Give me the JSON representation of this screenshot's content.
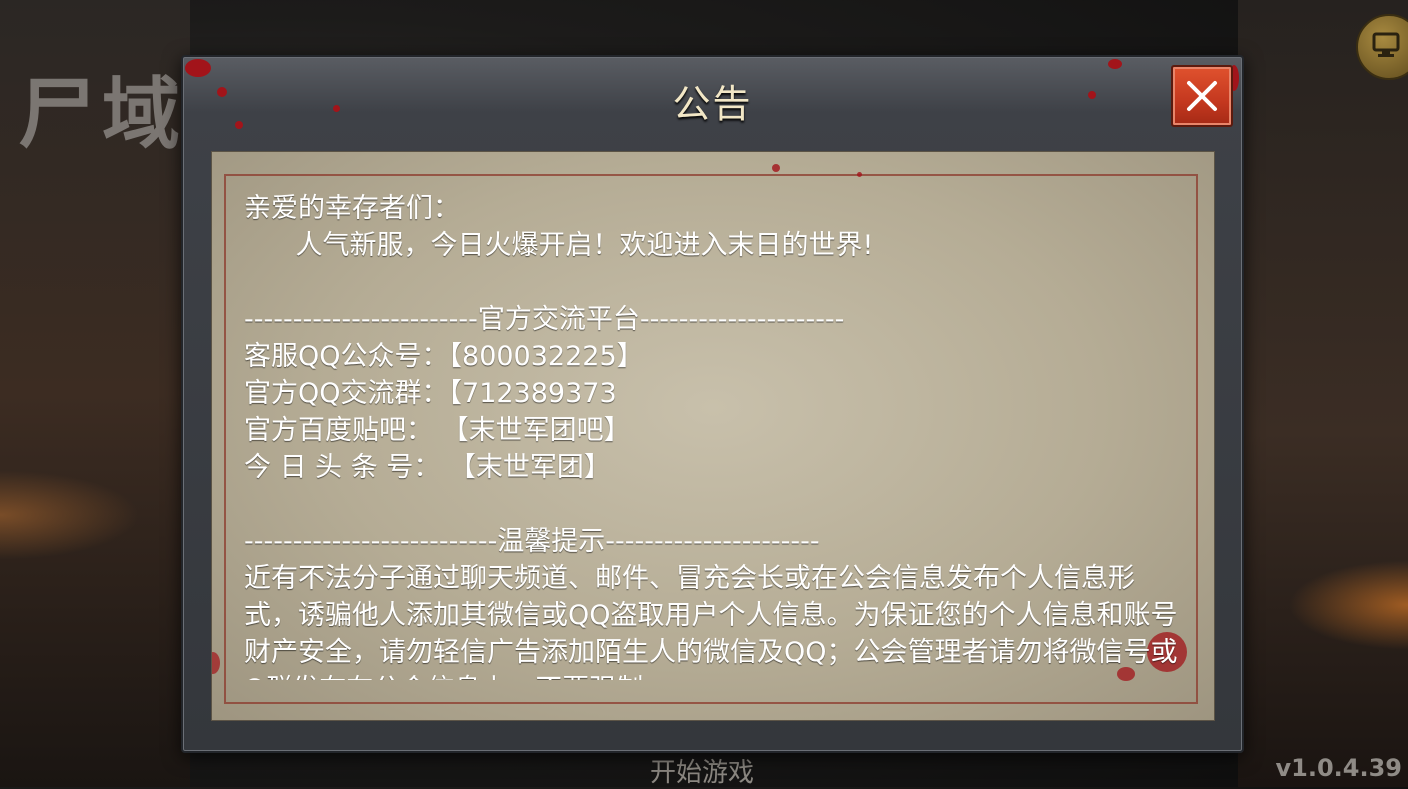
{
  "background": {
    "game_logo": "尸域",
    "start_button_label": "开始游戏",
    "version": "v1.0.4.39",
    "monitor_icon": "monitor-icon"
  },
  "dialog": {
    "title": "公告",
    "close_icon": "close-x-icon",
    "colors": {
      "title_text": "#f2e7c6",
      "close_button": "#d84a2a",
      "parchment": "#bdb49e",
      "body_text": "#ffffff",
      "frame_line": "#8c3a2c"
    },
    "greeting": "亲爱的幸存者们：",
    "intro": "      人气新服，今日火爆开启！欢迎进入末日的世界!",
    "section1_header": "------------------------官方交流平台---------------------",
    "contacts": [
      {
        "label": "客服QQ公众号：",
        "value": "【800032225】"
      },
      {
        "label": "官方QQ交流群：",
        "value": "【712389373"
      },
      {
        "label": "官方百度贴吧：",
        "value": " 【末世军团吧】"
      },
      {
        "label": "今 日 头 条 号：",
        "value": " 【末世军团】"
      }
    ],
    "section2_header": "--------------------------温馨提示----------------------",
    "tip_text": "近有不法分子通过聊天频道、邮件、冒充会长或在公会信息发布个人信息形式，诱骗他人添加其微信或QQ盗取用户个人信息。为保证您的个人信息和账号财产安全，请勿轻信广告添加陌生人的微信及QQ；公会管理者请勿将微信号或Q群发布在公会信息上，不要强制"
  }
}
